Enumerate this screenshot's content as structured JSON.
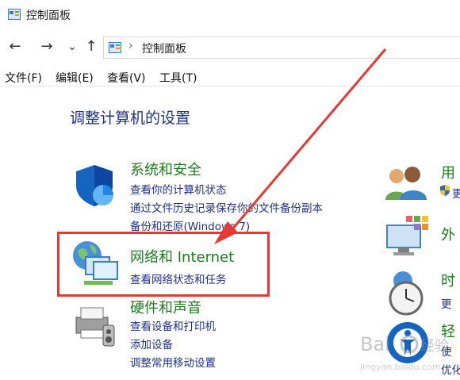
{
  "window": {
    "title": "控制面板",
    "icon": "control-panel-icon"
  },
  "nav": {
    "back": "←",
    "forward": "→",
    "recent": "⌄",
    "up": "↑",
    "separator": "›",
    "breadcrumb": "控制面板"
  },
  "menu": [
    "文件(F)",
    "编辑(E)",
    "查看(V)",
    "工具(T)"
  ],
  "heading": "调整计算机的设置",
  "categories": [
    {
      "title": "系统和安全",
      "icon": "shield-icon",
      "links": [
        "查看你的计算机状态",
        "通过文件历史记录保存你的文件备份副本",
        "备份和还原(Windows 7)"
      ]
    },
    {
      "title": "网络和 Internet",
      "icon": "network-icon",
      "links": [
        "查看网络状态和任务"
      ]
    },
    {
      "title": "硬件和声音",
      "icon": "printer-icon",
      "links": [
        "查看设备和打印机",
        "添加设备",
        "调整常用移动设置"
      ]
    }
  ],
  "right_categories": [
    {
      "title": "用",
      "icon": "users-icon",
      "links": [
        "更"
      ]
    },
    {
      "title": "外",
      "icon": "monitor-icon",
      "links": []
    },
    {
      "title": "时",
      "icon": "clock-icon",
      "links": [
        "更"
      ]
    },
    {
      "title": "轻",
      "icon": "accessibility-icon",
      "links": [
        "使",
        "优化"
      ]
    }
  ],
  "annotation": {
    "highlight_color": "#e53935",
    "arrow_color": "#e53935"
  },
  "watermark": {
    "text": "Bai 经验",
    "subtext": "jingyan.baidu.com"
  }
}
